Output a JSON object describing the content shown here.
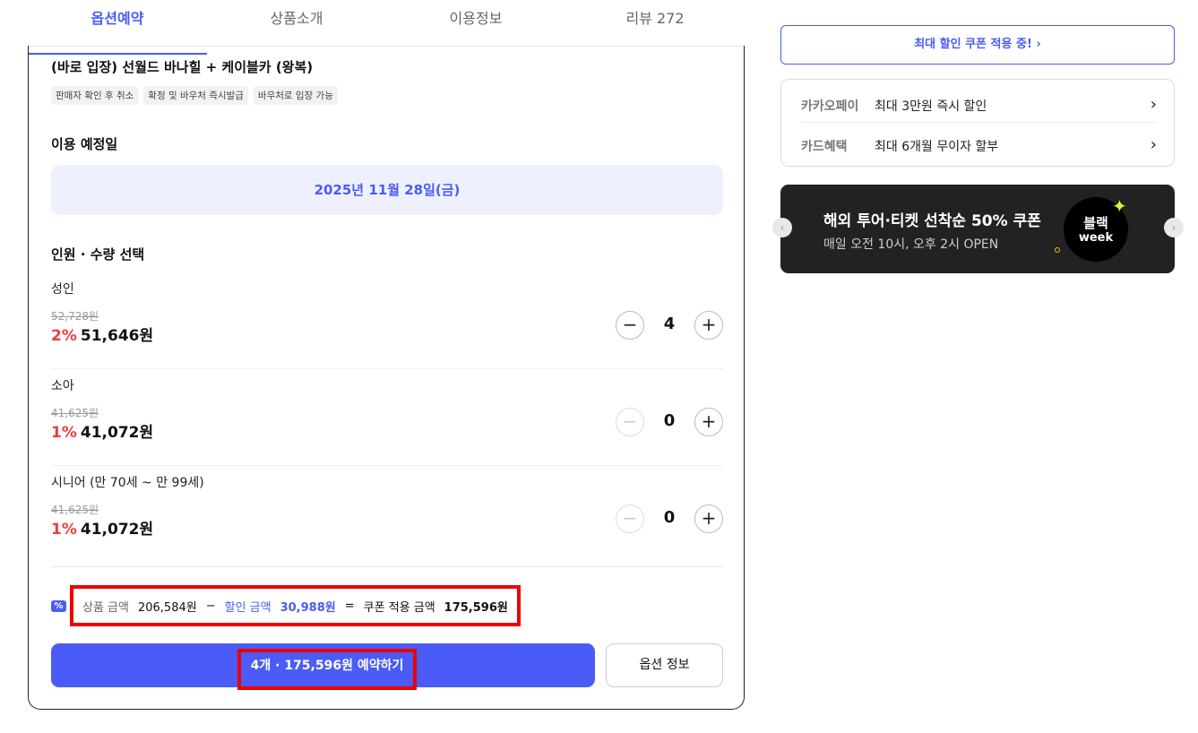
{
  "tabs": [
    {
      "label": "옵션예약"
    },
    {
      "label": "상품소개"
    },
    {
      "label": "이용정보"
    },
    {
      "label": "리뷰 272"
    }
  ],
  "product": {
    "title": "(바로 입장) 선월드 바나힐 + 케이블카 (왕복)",
    "chips": [
      "판매자 확인 후 취소",
      "확정 및 바우처 즉시발급",
      "바우처로 입장 가능"
    ]
  },
  "date_section": {
    "heading": "이용 예정일",
    "date": "2025년 11월 28일(금)"
  },
  "qty_section": {
    "heading": "인원 · 수량 선택",
    "rows": [
      {
        "label": "성인",
        "original": "52,728원",
        "discount": "2%",
        "price": "51,646원",
        "qty": "4",
        "minus": "−",
        "plus": "+"
      },
      {
        "label": "소아",
        "original": "41,625원",
        "discount": "1%",
        "price": "41,072원",
        "qty": "0",
        "minus": "−",
        "plus": "+"
      },
      {
        "label": "시니어 (만 70세 ~ 만 99세)",
        "original": "41,625원",
        "discount": "1%",
        "price": "41,072원",
        "qty": "0",
        "minus": "−",
        "plus": "+"
      }
    ]
  },
  "summary": {
    "coupon_icon": "%",
    "product_amount_label": "상품 금액",
    "product_amount": "206,584원",
    "minus": "−",
    "discount_label": "할인 금액",
    "discount_amount": "30,988원",
    "equals": "=",
    "coupon_applied_label": "쿠폰 적용 금액",
    "coupon_applied_amount": "175,596원"
  },
  "actions": {
    "book_label": "4개 · 175,596원 예약하기",
    "option_info_label": "옵션 정보"
  },
  "sidebar": {
    "coupon_button": "최대 할인 쿠폰 적용 중!",
    "coupon_chevron": "›",
    "payments": [
      {
        "name": "카카오페이",
        "benefit": "최대 3만원 즉시 할인",
        "chevron": "›"
      },
      {
        "name": "카드혜택",
        "benefit": "최대 6개월 무이자 할부",
        "chevron": "›"
      }
    ],
    "banner": {
      "title": "해외 투어·티켓 선착순 50% 쿠폰",
      "subtitle": "매일 오전 10시, 오후 2시 OPEN",
      "badge_top": "블랙",
      "badge_bottom": "week",
      "spark": "✦",
      "prev": "‹",
      "next": "›"
    }
  },
  "colors": {
    "accent": "#4a5cf5",
    "discount": "#f03b3b",
    "highlight": "#ee0000",
    "banner_bg": "#222222"
  }
}
